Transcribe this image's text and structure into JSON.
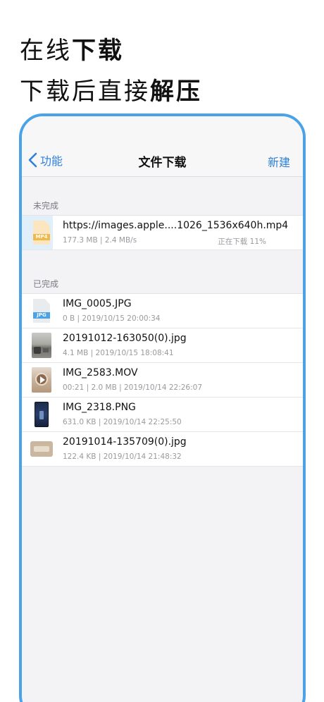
{
  "promo": {
    "line1_light": "在线",
    "line1_bold": "下载",
    "line2_light": "下载后直接",
    "line2_bold": "解压"
  },
  "nav": {
    "back_label": "功能",
    "title": "文件下载",
    "new_label": "新建"
  },
  "sections": {
    "incomplete": "未完成",
    "complete": "已完成"
  },
  "downloading": [
    {
      "name": "https://images.apple....1026_1536x640h.mp4",
      "meta": "177.3 MB | 2.4 MB/s",
      "status": "正在下载 11%",
      "progress_percent": 11,
      "icon_ext": "MP4",
      "icon": "mp4-file-icon"
    }
  ],
  "completed": [
    {
      "name": "IMG_0005.JPG",
      "meta": "0 B | 2019/10/15 20:00:34",
      "icon": "jpg-file-icon",
      "icon_ext": "JPG"
    },
    {
      "name": "20191012-163050(0).jpg",
      "meta": "4.1 MB | 2019/10/15 18:08:41",
      "icon": "photo-thumbnail"
    },
    {
      "name": "IMG_2583.MOV",
      "meta": "00:21 | 2.0 MB | 2019/10/14 22:26:07",
      "icon": "video-thumbnail"
    },
    {
      "name": "IMG_2318.PNG",
      "meta": "631.0 KB | 2019/10/14 22:25:50",
      "icon": "screenshot-thumbnail"
    },
    {
      "name": "20191014-135709(0).jpg",
      "meta": "122.4 KB | 2019/10/14 21:48:32",
      "icon": "photo-thumbnail"
    }
  ],
  "colors": {
    "accent": "#2f80d8",
    "frame": "#4aa3e8",
    "progress": "#e1effb",
    "jpg_badge": "#4aa3e8",
    "mp4_badge": "#f0b94a"
  }
}
